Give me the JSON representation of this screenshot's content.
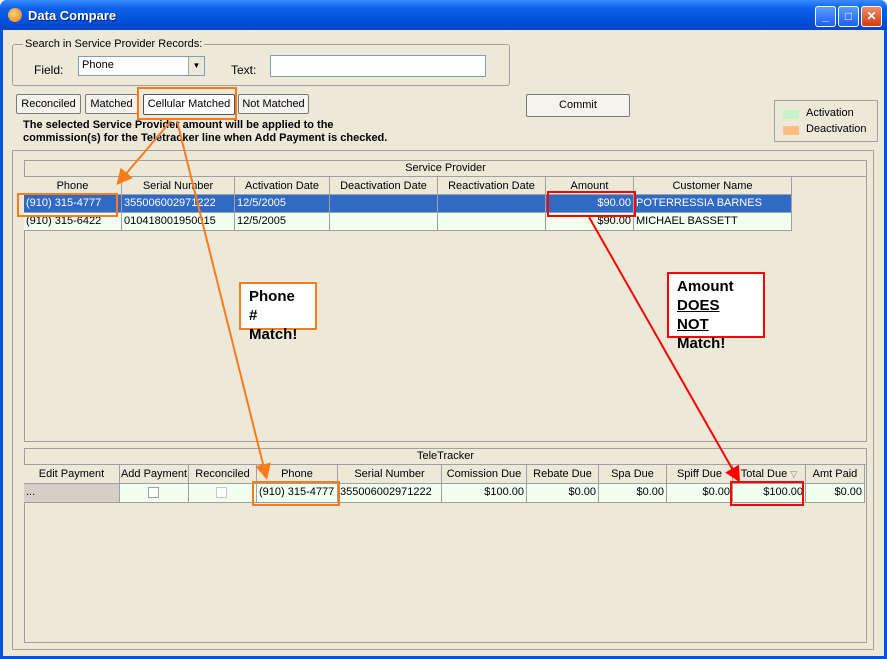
{
  "window": {
    "title": "Data Compare"
  },
  "search": {
    "group_label": "Search in Service Provider Records:",
    "field_label": "Field:",
    "field_value": "Phone",
    "text_label": "Text:",
    "text_value": ""
  },
  "tabs": [
    "Reconciled",
    "Matched",
    "Cellular Matched",
    "Not Matched"
  ],
  "commit_label": "Commit",
  "note": {
    "line1": "The selected Service Provider amount will be applied to the",
    "line2": "commission(s) for the Teletracker line  when Add Payment is checked."
  },
  "legend": {
    "activation": "Activation",
    "deactivation": "Deactivation"
  },
  "colors": {
    "activation": "#c8f2c8",
    "deactivation": "#ffbe82",
    "selection": "#316ac5",
    "row_bg": "#f0fff0",
    "orange": "#ff7a1a",
    "red": "#ff0000"
  },
  "service_provider": {
    "caption": "Service Provider",
    "columns": [
      "Phone",
      "Serial Number",
      "Activation Date",
      "Deactivation Date",
      "Reactivation Date",
      "Amount",
      "Customer Name"
    ],
    "rows": [
      [
        "(910) 315-4777",
        "355006002971222",
        "12/5/2005",
        "",
        "",
        "$90.00",
        "POTERRESSIA BARNES"
      ],
      [
        "(910) 315-6422",
        "010418001950015",
        "12/5/2005",
        "",
        "",
        "$90.00",
        "MICHAEL BASSETT"
      ]
    ]
  },
  "teletracker": {
    "caption": "TeleTracker",
    "columns": [
      "Edit Payment",
      "Add Payment",
      "Reconciled",
      "Phone",
      "Serial Number",
      "Comission Due",
      "Rebate Due",
      "Spa Due",
      "Spiff Due",
      "Total Due",
      "Amt Paid"
    ],
    "sort_icon": "sort-desc-icon",
    "row": {
      "edit": "...",
      "phone": "(910) 315-4777",
      "serial": "355006002971222",
      "comission": "$100.00",
      "rebate": "$0.00",
      "spa": "$0.00",
      "spiff": "$0.00",
      "total": "$100.00",
      "paid": "$0.00"
    }
  },
  "callouts": {
    "phone_line1": "Phone #",
    "phone_line2": "Match!",
    "amount_line1": "Amount",
    "amount_line2": "DOES NOT",
    "amount_line3": "Match!"
  }
}
